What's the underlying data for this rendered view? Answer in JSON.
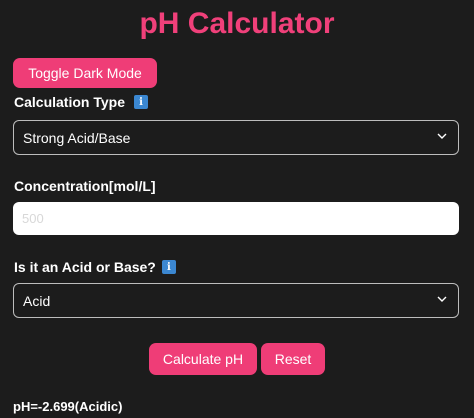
{
  "app": {
    "title": "pH Calculator"
  },
  "toggle": {
    "label": "Toggle Dark Mode"
  },
  "calculation_type": {
    "label": "Calculation Type",
    "info_icon": "i",
    "selected": "Strong Acid/Base"
  },
  "concentration": {
    "label": "Concentration[mol/L]",
    "placeholder": "500",
    "value": ""
  },
  "acid_or_base": {
    "label": "Is it an Acid or Base?",
    "info_icon": "i",
    "selected": "Acid"
  },
  "actions": {
    "calculate_label": "Calculate pH",
    "reset_label": "Reset"
  },
  "result": {
    "text": "pH=-2.699(Acidic)"
  },
  "colors": {
    "accent": "#ef3d77",
    "background": "#1c1c1c",
    "info": "#3b87d1"
  }
}
